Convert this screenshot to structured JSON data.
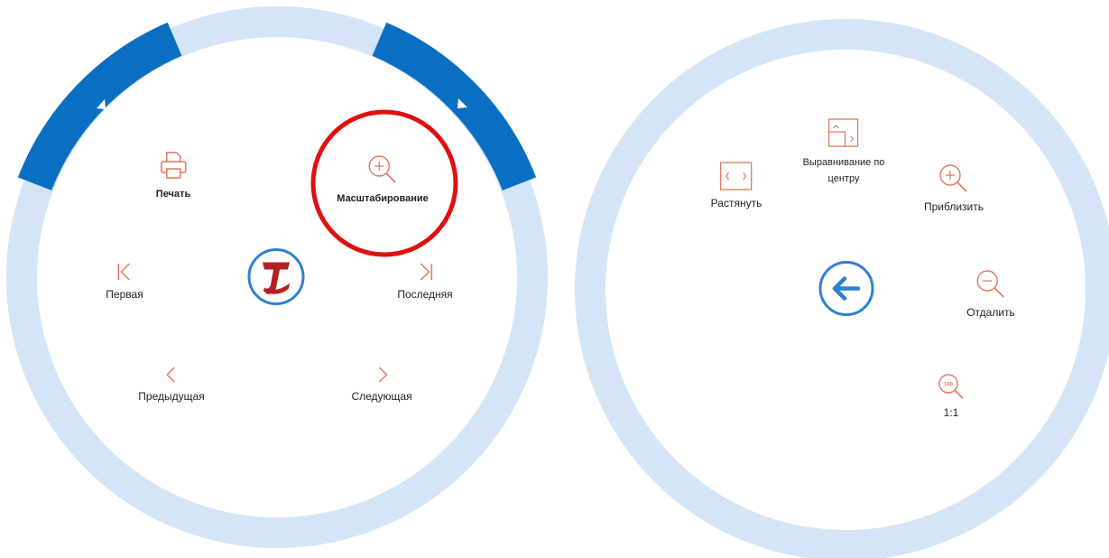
{
  "colors": {
    "ring": "#d3e5f6",
    "active_segment": "#0a6fc2",
    "icon_accent": "#e07a5f",
    "highlight": "#e01010",
    "center_blue": "#2f80d1",
    "logo_red": "#b41f24"
  },
  "left_menu": {
    "center_icon": "logo-icon",
    "items": [
      {
        "id": "print",
        "label": "Печать",
        "icon": "printer-icon"
      },
      {
        "id": "zoom",
        "label": "Масштабирование",
        "icon": "zoom-in-icon",
        "highlighted": true
      },
      {
        "id": "first",
        "label": "Первая",
        "icon": "first-page-icon"
      },
      {
        "id": "last",
        "label": "Последняя",
        "icon": "last-page-icon"
      },
      {
        "id": "prev",
        "label": "Предыдущая",
        "icon": "chevron-left-icon"
      },
      {
        "id": "next",
        "label": "Следующая",
        "icon": "chevron-right-icon"
      }
    ]
  },
  "right_menu": {
    "center_icon": "back-arrow-icon",
    "items": [
      {
        "id": "center",
        "label_line1": "Выравнивание по",
        "label_line2": "центру",
        "icon": "align-center-icon"
      },
      {
        "id": "stretch",
        "label": "Растянуть",
        "icon": "stretch-icon"
      },
      {
        "id": "zoom_in",
        "label": "Приблизить",
        "icon": "zoom-in-icon"
      },
      {
        "id": "zoom_out",
        "label": "Отдалить",
        "icon": "zoom-out-icon"
      },
      {
        "id": "actual",
        "label": "1:1",
        "icon": "actual-size-icon"
      }
    ]
  }
}
